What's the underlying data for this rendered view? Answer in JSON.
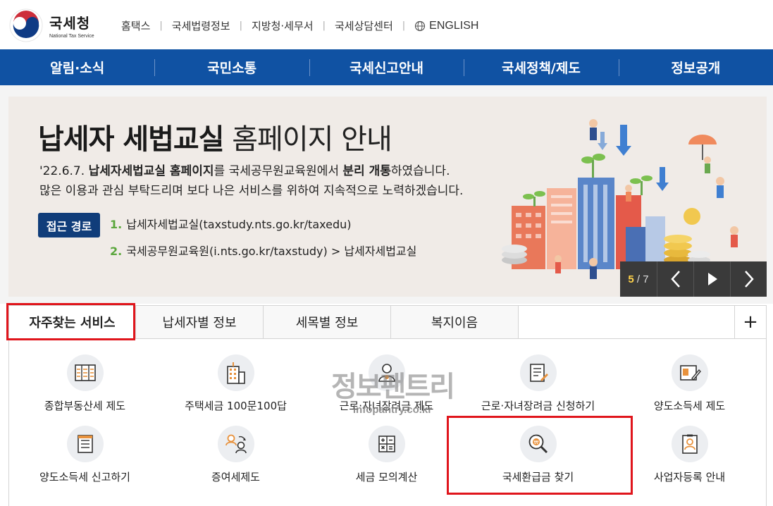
{
  "header": {
    "logo_ko": "국세청",
    "logo_en": "National Tax Service",
    "links": [
      "홈택스",
      "국세법령정보",
      "지방청·세무서",
      "국세상담센터"
    ],
    "english_label": "ENGLISH"
  },
  "nav": {
    "items": [
      "알림·소식",
      "국민소통",
      "국세신고안내",
      "국세정책/제도",
      "정보공개"
    ],
    "background": "#1052a3"
  },
  "banner": {
    "title_bold": "납세자 세법교실",
    "title_light": " 홈페이지 안내",
    "desc_line1_a": "'22.6.7. ",
    "desc_line1_b": "납세자세법교실 홈페이지",
    "desc_line1_c": "를 국세공무원교육원에서 ",
    "desc_line1_d": "분리 개통",
    "desc_line1_e": "하였습니다.",
    "desc_line2": "많은 이용과 관심 부탁드리며 보다 나은 서비스를 위하여 지속적으로 노력하겠습니다.",
    "route_badge": "접근 경로",
    "route1_num": "1.",
    "route1_text": "납세자세법교실(taxstudy.nts.go.kr/taxedu)",
    "route2_num": "2.",
    "route2_text": "국세공무원교육원(i.nts.go.kr/taxstudy) > 납세자세법교실"
  },
  "slider": {
    "current": "5",
    "total": "/ 7"
  },
  "tabs": {
    "items": [
      "자주찾는 서비스",
      "납세자별 정보",
      "세목별 정보",
      "복지이음"
    ],
    "active_index": 0,
    "more_label": "+"
  },
  "services": [
    {
      "label": "종합부동산세 제도",
      "icon": "building-document-icon"
    },
    {
      "label": "주택세금 100문100답",
      "icon": "apartment-icon"
    },
    {
      "label": "근로·자녀장려금 제도",
      "icon": "family-icon"
    },
    {
      "label": "근로·자녀장려금 신청하기",
      "icon": "form-pen-icon"
    },
    {
      "label": "양도소득세 제도",
      "icon": "transfer-pen-icon"
    },
    {
      "label": "양도소득세 신고하기",
      "icon": "report-icon"
    },
    {
      "label": "증여세제도",
      "icon": "gift-people-icon"
    },
    {
      "label": "세금 모의계산",
      "icon": "calculator-icon"
    },
    {
      "label": "국세환급금 찾기",
      "icon": "refund-search-icon"
    },
    {
      "label": "사업자등록 안내",
      "icon": "business-id-icon"
    }
  ],
  "watermark": {
    "ko": "정보팬트리",
    "en": "infopantry.co.kr"
  },
  "colors": {
    "nav_blue": "#1052a3",
    "badge_navy": "#103d7a",
    "highlight_red": "#e0151c",
    "route_green": "#5aa63c"
  }
}
